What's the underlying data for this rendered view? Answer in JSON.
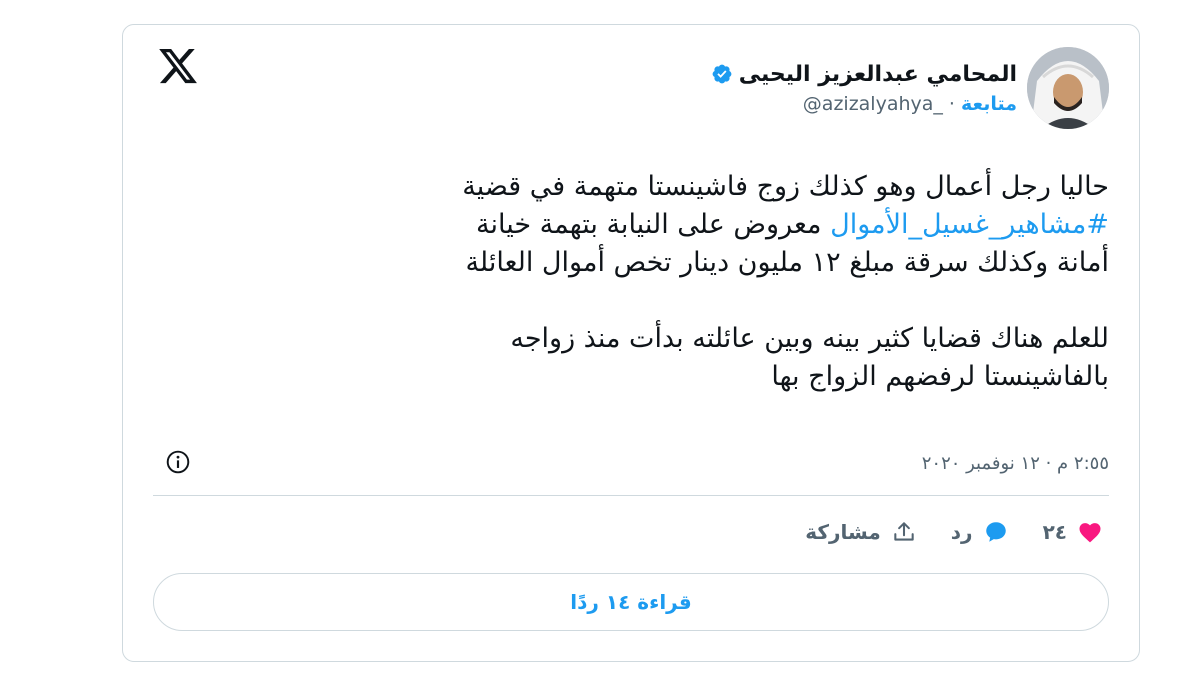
{
  "author": {
    "name": "المحامي عبدالعزيز اليحيى",
    "handle": "@azizalyahya_",
    "separator": "·",
    "follow_label": "متابعة"
  },
  "tweet": {
    "line1": "حاليا رجل أعمال وهو كذلك زوج فاشينستا متهمة في قضية",
    "hashtag": "#مشاهير_غسيل_الأموال",
    "line2_rest": " معروض على النيابة بتهمة خيانة",
    "line3": "أمانة وكذلك سرقة مبلغ ١٢ مليون دينار تخص أموال العائلة",
    "line4": "للعلم هناك قضايا كثير بينه وبين عائلته بدأت منذ زواجه",
    "line5": "بالفاشينستا لرفضهم الزواج بها"
  },
  "timestamp": "٢:٥٥ م · ١٢ نوفمبر ٢٠٢٠",
  "actions": {
    "likes_count": "٢٤",
    "reply_label": "رد",
    "share_label": "مشاركة"
  },
  "read_replies_label": "قراءة ١٤ ردًا",
  "colors": {
    "accent": "#1d9bf0",
    "like": "#f91880",
    "text": "#0f1419",
    "muted": "#536471",
    "border": "#cfd9de"
  },
  "icons": [
    "x-logo-icon",
    "verified-badge-icon",
    "info-icon",
    "heart-icon",
    "reply-bubble-icon",
    "share-icon"
  ]
}
